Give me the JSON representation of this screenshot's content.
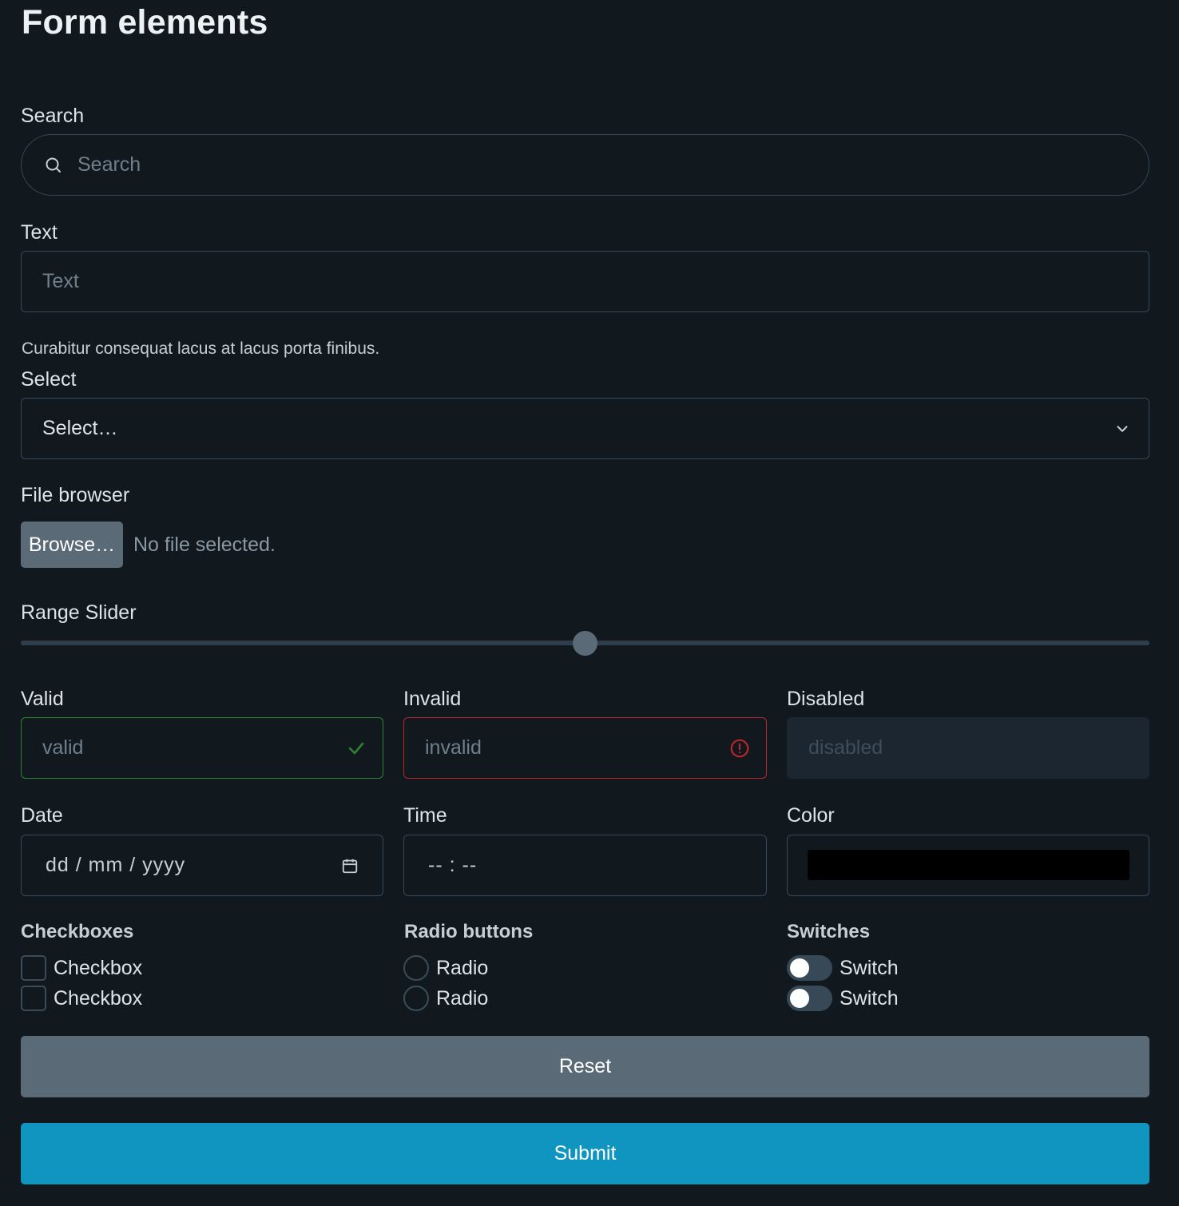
{
  "page": {
    "title": "Form elements"
  },
  "search": {
    "label": "Search",
    "placeholder": "Search",
    "icon": "search-icon"
  },
  "text": {
    "label": "Text",
    "placeholder": "Text",
    "helper": "Curabitur consequat lacus at lacus porta finibus."
  },
  "select": {
    "label": "Select",
    "value": "Select…",
    "icon": "chevron-down-icon"
  },
  "file": {
    "label": "File browser",
    "button_label": "Browse…",
    "status": "No file selected."
  },
  "range": {
    "label": "Range Slider",
    "value_fraction": 0.5
  },
  "validation": {
    "valid": {
      "label": "Valid",
      "placeholder": "valid",
      "icon": "check-icon",
      "color": "#2f8132"
    },
    "invalid": {
      "label": "Invalid",
      "placeholder": "invalid",
      "icon": "alert-circle-icon",
      "color": "#b7262b"
    },
    "disabled": {
      "label": "Disabled",
      "placeholder": "disabled"
    }
  },
  "date": {
    "label": "Date",
    "value": "dd / mm / yyyy",
    "icon": "calendar-icon"
  },
  "time": {
    "label": "Time",
    "value": "-- : --"
  },
  "color": {
    "label": "Color",
    "value": "#000000"
  },
  "checkboxes": {
    "title": "Checkboxes",
    "items": [
      {
        "label": "Checkbox"
      },
      {
        "label": "Checkbox"
      }
    ]
  },
  "radios": {
    "title": "Radio buttons",
    "items": [
      {
        "label": "Radio"
      },
      {
        "label": "Radio"
      }
    ]
  },
  "switches": {
    "title": "Switches",
    "items": [
      {
        "label": "Switch"
      },
      {
        "label": "Switch"
      }
    ]
  },
  "buttons": {
    "reset_label": "Reset",
    "submit_label": "Submit",
    "submit_color": "#1095c1"
  }
}
